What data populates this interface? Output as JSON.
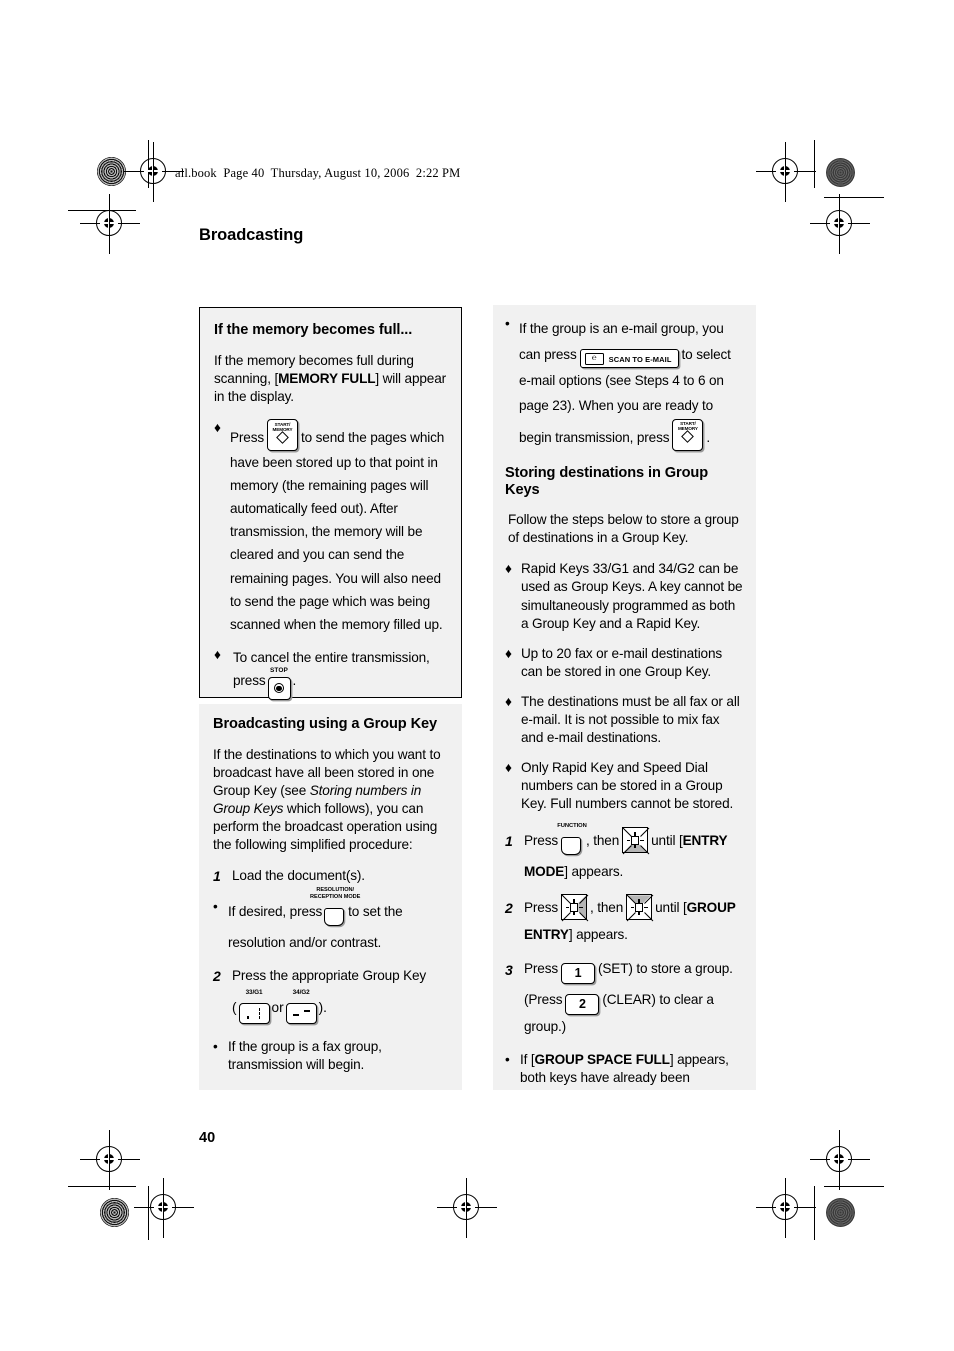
{
  "header": {
    "book_line": "all.book  Page 40  Thursday, August 10, 2006  2:22 PM"
  },
  "chapter_title": "Broadcasting",
  "page_number": "40",
  "colors": {
    "panel_background": "#f1f1f1",
    "page_background": "#ffffff",
    "text": "#000000",
    "key_highlight": "#b5b5b5"
  },
  "left_column": {
    "memory_box": {
      "heading": "If the memory becomes full...",
      "intro_prefix": "If the memory becomes full during scanning, [",
      "intro_bold": "MEMORY FULL",
      "intro_suffix": "] will appear in the display.",
      "bullets": [
        {
          "marker": "♦",
          "text_before_key": "Press",
          "key": {
            "name": "start-memory-key",
            "caption_line1": "START/",
            "caption_line2": "MEMORY"
          },
          "text_after_key": "to send the pages which have been stored up to that point in memory (the remaining pages will automatically feed out). After transmission, the memory will be cleared and you can send the remaining pages. You will also need to send the page which was being scanned when the memory filled up."
        },
        {
          "marker": "♦",
          "text_before_key": "To cancel the entire transmission, press",
          "key": {
            "name": "stop-key",
            "caption": "STOP"
          },
          "text_after_key": "."
        }
      ]
    },
    "group_key_section": {
      "heading": "Broadcasting using a Group Key",
      "intro_part1": "If the destinations to which you want to broadcast have all been stored in one Group Key (see ",
      "intro_italic": "Storing numbers in Group Keys",
      "intro_part2": " which follows), you can perform the broadcast operation using the following simplified procedure:",
      "steps": [
        {
          "number": "1",
          "text": "Load the document(s)."
        }
      ],
      "bullet_resolution": {
        "marker": "•",
        "text_before_key": "If desired, press",
        "key": {
          "name": "resolution-reception-mode-key",
          "caption_line1": "RESOLUTION/",
          "caption_line2": "RECEPTION MODE"
        },
        "text_after_key": "to set the resolution and/or contrast."
      },
      "step2": {
        "number": "2",
        "text": "Press the appropriate Group Key",
        "key_open_paren": "(",
        "key1": {
          "name": "rapid-key-33-g1",
          "caption": "33/G1"
        },
        "between": "or",
        "key2": {
          "name": "rapid-key-34-g2",
          "caption": "34/G2"
        },
        "key_close_paren": ")."
      },
      "bullet_fax_group": {
        "marker": "•",
        "text": "If the group is a fax group, transmission will begin."
      }
    }
  },
  "right_column": {
    "email_bullet": {
      "marker": "•",
      "text_1": "If the group is an e-mail group, you can press",
      "scan_key": {
        "name": "scan-to-email-key",
        "icon": "envelope-at-icon",
        "label": "SCAN TO E-MAIL"
      },
      "text_2": "to select e-mail options (see Steps 4 to 6  on page 23). When you are ready to begin transmission, press",
      "start_key": {
        "name": "start-memory-key",
        "caption_line1": "START/",
        "caption_line2": "MEMORY"
      },
      "text_3": "."
    },
    "storing_section": {
      "heading": "Storing destinations in Group Keys",
      "intro": "Follow the steps below to store a group of destinations in a Group Key.",
      "bullets": [
        {
          "marker": "♦",
          "text": "Rapid Keys 33/G1 and 34/G2 can be used as Group Keys. A key cannot be simultaneously programmed as both a Group Key and a Rapid Key."
        },
        {
          "marker": "♦",
          "text": "Up to 20 fax or e-mail destinations can be stored in one Group Key."
        },
        {
          "marker": "♦",
          "text": "The destinations must be all fax or all e-mail. It is not possible to mix fax and e-mail destinations."
        },
        {
          "marker": "♦",
          "text": "Only Rapid Key and Speed Dial numbers can be stored in a Group Key. Full numbers cannot be stored."
        }
      ],
      "step1": {
        "number": "1",
        "text_1": "Press",
        "function_key": {
          "name": "function-key",
          "caption": "FUNCTION"
        },
        "text_2": ", then",
        "nav_key": {
          "name": "nav-key-down",
          "highlight": "bottom"
        },
        "text_3": "until [",
        "bold": "ENTRY MODE",
        "text_4": "] appears."
      },
      "step2": {
        "number": "2",
        "text_1": "Press",
        "nav_key_1": {
          "name": "nav-key-right",
          "highlight": "right"
        },
        "text_2": ", then",
        "nav_key_2": {
          "name": "nav-key-up",
          "highlight": "top"
        },
        "text_3": "until [",
        "bold": "GROUP ENTRY",
        "text_4": "] appears."
      },
      "step3": {
        "number": "3",
        "text_1": "Press",
        "key_1": {
          "name": "numeric-key-1",
          "label": "1"
        },
        "text_2": "(SET) to store a group.",
        "text_3": "(Press",
        "key_2": {
          "name": "numeric-key-2",
          "label": "2"
        },
        "text_4": "(CLEAR) to clear a group.)"
      },
      "bullet_space_full": {
        "marker": "•",
        "text_1": "If [",
        "bold": "GROUP SPACE FULL",
        "text_2": "] appears, both keys have already been"
      }
    }
  }
}
